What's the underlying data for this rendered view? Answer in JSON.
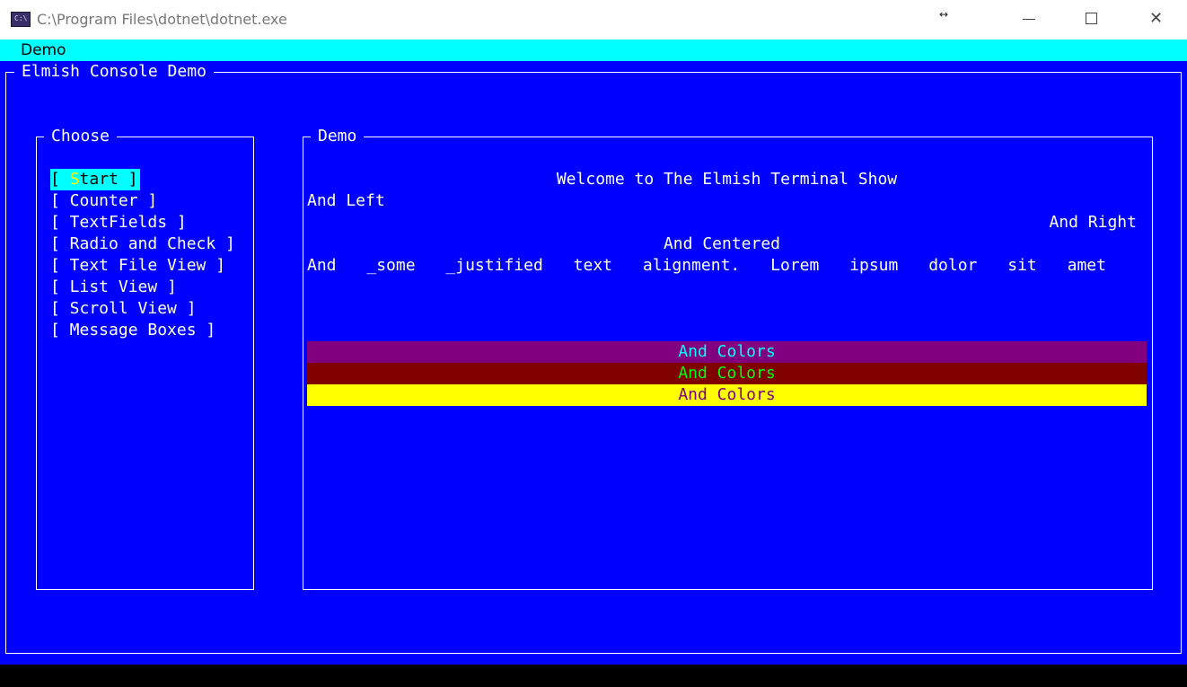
{
  "window": {
    "title": "C:\\Program Files\\dotnet\\dotnet.exe",
    "icon_glyph": "C:\\",
    "controls": [
      "minimize-icon",
      "maximize-icon",
      "close-icon"
    ],
    "close_glyph": "✕",
    "resize_glyph": "↔"
  },
  "menubar": {
    "items": [
      {
        "label": "Demo"
      }
    ]
  },
  "main_frame": {
    "title": "Elmish Console Demo"
  },
  "choose": {
    "title": "Choose",
    "items": [
      {
        "pre": "[ ",
        "hot": "S",
        "rest": "tart",
        "post": " ]",
        "selected": true
      },
      {
        "text": "[ Counter ]"
      },
      {
        "text": "[ TextFields ]"
      },
      {
        "text": "[ Radio and Check ]"
      },
      {
        "text": "[ Text File View ]"
      },
      {
        "text": "[ List View ]"
      },
      {
        "text": "[ Scroll View ]"
      },
      {
        "text": "[ Message Boxes ]"
      }
    ]
  },
  "demo": {
    "title": "Demo",
    "welcome": "Welcome to The Elmish Terminal Show",
    "left": "And Left",
    "right": "And Right",
    "centered": "And Centered",
    "justified_words": [
      "And",
      "_some",
      "_justified",
      "text",
      "alignment.",
      "Lorem",
      "ipsum",
      "dolor",
      "sit",
      "amet"
    ],
    "color_bands": [
      {
        "text": "And Colors",
        "bg": "#800080",
        "fg": "#00ffff"
      },
      {
        "text": "And Colors",
        "bg": "#800000",
        "fg": "#00ff00"
      },
      {
        "text": "And Colors",
        "bg": "#ffff00",
        "fg": "#800080"
      }
    ]
  },
  "colors": {
    "console_bg": "#0000ff",
    "menubar_bg": "#00ffff",
    "frame": "#ffffff"
  }
}
